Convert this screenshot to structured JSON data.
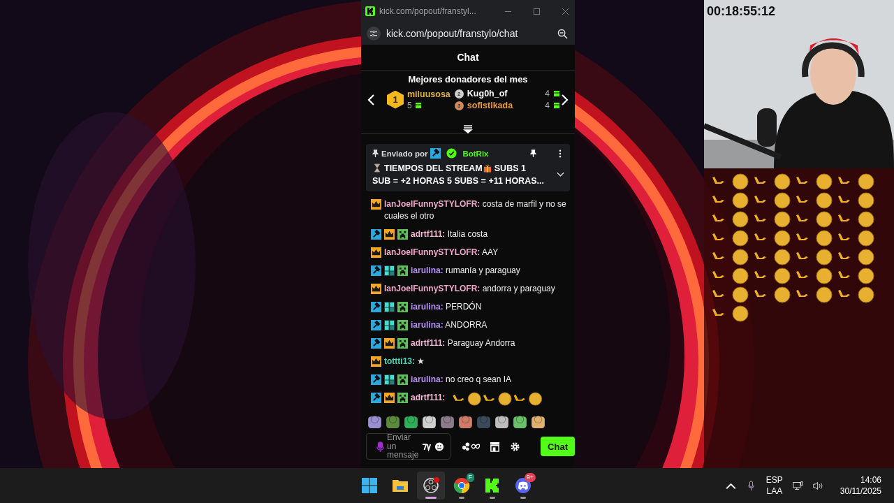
{
  "browser": {
    "tab_title": "kick.com/popout/franstyl...",
    "url": "kick.com/popout/franstylo/chat"
  },
  "chat": {
    "title": "Chat",
    "donors_title": "Mejores donadores del mes",
    "donors": [
      {
        "rank": "1",
        "name": "miluusosa",
        "count": "5",
        "color": "#e0b04a"
      },
      {
        "rank": "2",
        "name": "Kug0h_of",
        "count": "4",
        "color": "#ffffff"
      },
      {
        "rank": "3",
        "name": "sofistikada",
        "count": "4",
        "color": "#e89a3c"
      }
    ],
    "pinned": {
      "sent_by": "Enviado por",
      "author": "BotRix",
      "title": "TIEMPOS DEL STREAM",
      "text_start": "SUBS 1",
      "text": "SUB = +2 HORAS 5 SUBS = +11 HORAS..."
    },
    "messages": [
      {
        "badges": [
          {
            "kind": "vip"
          }
        ],
        "user": "IanJoelFunnySTYLOFR:",
        "color": "#f0a6c8",
        "text": "costa de marfil y no se cuales el otro"
      },
      {
        "badges": [
          {
            "kind": "mod"
          },
          {
            "kind": "vip"
          },
          {
            "kind": "creeper"
          }
        ],
        "user": "adrtf111:",
        "color": "#f3b9d2",
        "text": "Italia costa"
      },
      {
        "badges": [
          {
            "kind": "vip"
          }
        ],
        "user": "IanJoelFunnySTYLOFR:",
        "color": "#f0a6c8",
        "text": "AAY"
      },
      {
        "badges": [
          {
            "kind": "mod"
          },
          {
            "kind": "og"
          },
          {
            "kind": "creeper"
          }
        ],
        "user": "iarulina:",
        "color": "#b690f2",
        "text": "rumanía y paraguay"
      },
      {
        "badges": [
          {
            "kind": "vip"
          }
        ],
        "user": "IanJoelFunnySTYLOFR:",
        "color": "#f0a6c8",
        "text": "andorra y paraguay"
      },
      {
        "badges": [
          {
            "kind": "mod"
          },
          {
            "kind": "og"
          },
          {
            "kind": "creeper"
          }
        ],
        "user": "iarulina:",
        "color": "#b690f2",
        "text": "PERDÓN"
      },
      {
        "badges": [
          {
            "kind": "mod"
          },
          {
            "kind": "og"
          },
          {
            "kind": "creeper"
          }
        ],
        "user": "iarulina:",
        "color": "#b690f2",
        "text": "ANDORRA"
      },
      {
        "badges": [
          {
            "kind": "mod"
          },
          {
            "kind": "vip"
          },
          {
            "kind": "creeper"
          }
        ],
        "user": "adrtf111:",
        "color": "#f3b9d2",
        "text": "Paraguay Andorra"
      },
      {
        "badges": [
          {
            "kind": "vip"
          }
        ],
        "user": "tottti13:",
        "color": "#4fd6b4",
        "text": "★"
      },
      {
        "badges": [
          {
            "kind": "mod"
          },
          {
            "kind": "og"
          },
          {
            "kind": "creeper"
          }
        ],
        "user": "iarulina:",
        "color": "#b690f2",
        "text": "no creo q sean IA"
      },
      {
        "badges": [
          {
            "kind": "mod"
          },
          {
            "kind": "vip"
          },
          {
            "kind": "creeper"
          }
        ],
        "user": "adrtf111:",
        "color": "#f3b9d2",
        "kind": "emotes"
      }
    ],
    "input": {
      "placeholder": "Enviar un mensaje"
    },
    "send_button": "Chat"
  },
  "overlay": {
    "timer": "00:18:55:12"
  },
  "taskbar": {
    "apps": [
      {
        "kind": "windows",
        "selected": false,
        "running": false
      },
      {
        "kind": "folder",
        "selected": false,
        "running": false
      },
      {
        "kind": "obs",
        "selected": true,
        "running": true
      },
      {
        "kind": "chrome",
        "selected": false,
        "running": true,
        "badge": "F"
      },
      {
        "kind": "kick",
        "selected": false,
        "running": true
      },
      {
        "kind": "discord",
        "selected": false,
        "running": true,
        "badge": "9+"
      }
    ],
    "language": "ESP",
    "layout": "LAA",
    "time": "14:06",
    "date": "30/11/2025"
  }
}
